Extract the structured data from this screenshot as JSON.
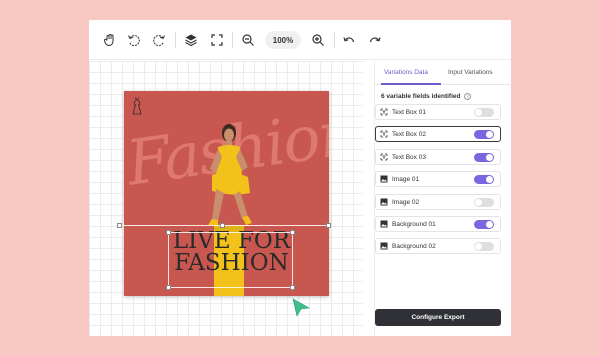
{
  "toolbar": {
    "zoom_level": "100%",
    "tools": [
      "hand-icon",
      "rotate-left-icon",
      "rotate-right-icon",
      "layers-icon",
      "fit-screen-icon",
      "zoom-out-icon",
      "zoom-in-icon",
      "undo-icon",
      "redo-icon"
    ]
  },
  "canvas": {
    "background_script": "Fashion",
    "headline_line1": "LIVE FOR",
    "headline_line2": "FASHION",
    "artboard_color": "#c8574f",
    "accent_yellow": "#f2c21b"
  },
  "panel": {
    "tabs": [
      {
        "label": "Variations Data",
        "active": true
      },
      {
        "label": "Input Variations",
        "active": false
      }
    ],
    "info_text": "6 variable fields identified",
    "fields": [
      {
        "label": "Text Box 01",
        "icon": "text-box-icon",
        "enabled": false,
        "selected": false
      },
      {
        "label": "Text Box 02",
        "icon": "text-box-icon",
        "enabled": true,
        "selected": true
      },
      {
        "label": "Text Box 03",
        "icon": "text-box-icon",
        "enabled": true,
        "selected": false
      },
      {
        "label": "Image 01",
        "icon": "image-icon",
        "enabled": true,
        "selected": false
      },
      {
        "label": "Image 02",
        "icon": "image-icon",
        "enabled": false,
        "selected": false
      },
      {
        "label": "Background 01",
        "icon": "image-icon",
        "enabled": true,
        "selected": false
      },
      {
        "label": "Background 02",
        "icon": "image-icon",
        "enabled": false,
        "selected": false
      }
    ],
    "export_label": "Configure Export"
  },
  "colors": {
    "page_bg": "#f8c9c2",
    "toggle_on": "#7a67e0",
    "tab_active": "#6b5fc7",
    "button_dark": "#2f3136"
  }
}
